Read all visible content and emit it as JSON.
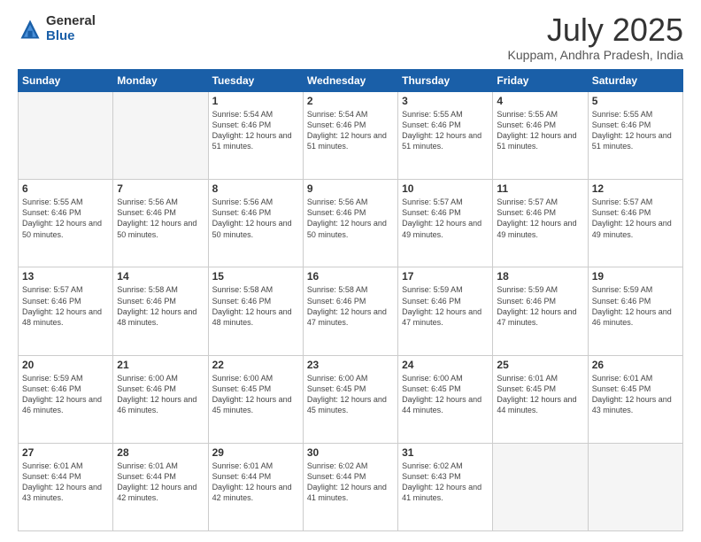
{
  "header": {
    "logo_general": "General",
    "logo_blue": "Blue",
    "title": "July 2025",
    "location": "Kuppam, Andhra Pradesh, India"
  },
  "days_of_week": [
    "Sunday",
    "Monday",
    "Tuesday",
    "Wednesday",
    "Thursday",
    "Friday",
    "Saturday"
  ],
  "weeks": [
    [
      {
        "day": "",
        "info": ""
      },
      {
        "day": "",
        "info": ""
      },
      {
        "day": "1",
        "info": "Sunrise: 5:54 AM\nSunset: 6:46 PM\nDaylight: 12 hours and 51 minutes."
      },
      {
        "day": "2",
        "info": "Sunrise: 5:54 AM\nSunset: 6:46 PM\nDaylight: 12 hours and 51 minutes."
      },
      {
        "day": "3",
        "info": "Sunrise: 5:55 AM\nSunset: 6:46 PM\nDaylight: 12 hours and 51 minutes."
      },
      {
        "day": "4",
        "info": "Sunrise: 5:55 AM\nSunset: 6:46 PM\nDaylight: 12 hours and 51 minutes."
      },
      {
        "day": "5",
        "info": "Sunrise: 5:55 AM\nSunset: 6:46 PM\nDaylight: 12 hours and 51 minutes."
      }
    ],
    [
      {
        "day": "6",
        "info": "Sunrise: 5:55 AM\nSunset: 6:46 PM\nDaylight: 12 hours and 50 minutes."
      },
      {
        "day": "7",
        "info": "Sunrise: 5:56 AM\nSunset: 6:46 PM\nDaylight: 12 hours and 50 minutes."
      },
      {
        "day": "8",
        "info": "Sunrise: 5:56 AM\nSunset: 6:46 PM\nDaylight: 12 hours and 50 minutes."
      },
      {
        "day": "9",
        "info": "Sunrise: 5:56 AM\nSunset: 6:46 PM\nDaylight: 12 hours and 50 minutes."
      },
      {
        "day": "10",
        "info": "Sunrise: 5:57 AM\nSunset: 6:46 PM\nDaylight: 12 hours and 49 minutes."
      },
      {
        "day": "11",
        "info": "Sunrise: 5:57 AM\nSunset: 6:46 PM\nDaylight: 12 hours and 49 minutes."
      },
      {
        "day": "12",
        "info": "Sunrise: 5:57 AM\nSunset: 6:46 PM\nDaylight: 12 hours and 49 minutes."
      }
    ],
    [
      {
        "day": "13",
        "info": "Sunrise: 5:57 AM\nSunset: 6:46 PM\nDaylight: 12 hours and 48 minutes."
      },
      {
        "day": "14",
        "info": "Sunrise: 5:58 AM\nSunset: 6:46 PM\nDaylight: 12 hours and 48 minutes."
      },
      {
        "day": "15",
        "info": "Sunrise: 5:58 AM\nSunset: 6:46 PM\nDaylight: 12 hours and 48 minutes."
      },
      {
        "day": "16",
        "info": "Sunrise: 5:58 AM\nSunset: 6:46 PM\nDaylight: 12 hours and 47 minutes."
      },
      {
        "day": "17",
        "info": "Sunrise: 5:59 AM\nSunset: 6:46 PM\nDaylight: 12 hours and 47 minutes."
      },
      {
        "day": "18",
        "info": "Sunrise: 5:59 AM\nSunset: 6:46 PM\nDaylight: 12 hours and 47 minutes."
      },
      {
        "day": "19",
        "info": "Sunrise: 5:59 AM\nSunset: 6:46 PM\nDaylight: 12 hours and 46 minutes."
      }
    ],
    [
      {
        "day": "20",
        "info": "Sunrise: 5:59 AM\nSunset: 6:46 PM\nDaylight: 12 hours and 46 minutes."
      },
      {
        "day": "21",
        "info": "Sunrise: 6:00 AM\nSunset: 6:46 PM\nDaylight: 12 hours and 46 minutes."
      },
      {
        "day": "22",
        "info": "Sunrise: 6:00 AM\nSunset: 6:45 PM\nDaylight: 12 hours and 45 minutes."
      },
      {
        "day": "23",
        "info": "Sunrise: 6:00 AM\nSunset: 6:45 PM\nDaylight: 12 hours and 45 minutes."
      },
      {
        "day": "24",
        "info": "Sunrise: 6:00 AM\nSunset: 6:45 PM\nDaylight: 12 hours and 44 minutes."
      },
      {
        "day": "25",
        "info": "Sunrise: 6:01 AM\nSunset: 6:45 PM\nDaylight: 12 hours and 44 minutes."
      },
      {
        "day": "26",
        "info": "Sunrise: 6:01 AM\nSunset: 6:45 PM\nDaylight: 12 hours and 43 minutes."
      }
    ],
    [
      {
        "day": "27",
        "info": "Sunrise: 6:01 AM\nSunset: 6:44 PM\nDaylight: 12 hours and 43 minutes."
      },
      {
        "day": "28",
        "info": "Sunrise: 6:01 AM\nSunset: 6:44 PM\nDaylight: 12 hours and 42 minutes."
      },
      {
        "day": "29",
        "info": "Sunrise: 6:01 AM\nSunset: 6:44 PM\nDaylight: 12 hours and 42 minutes."
      },
      {
        "day": "30",
        "info": "Sunrise: 6:02 AM\nSunset: 6:44 PM\nDaylight: 12 hours and 41 minutes."
      },
      {
        "day": "31",
        "info": "Sunrise: 6:02 AM\nSunset: 6:43 PM\nDaylight: 12 hours and 41 minutes."
      },
      {
        "day": "",
        "info": ""
      },
      {
        "day": "",
        "info": ""
      }
    ]
  ]
}
